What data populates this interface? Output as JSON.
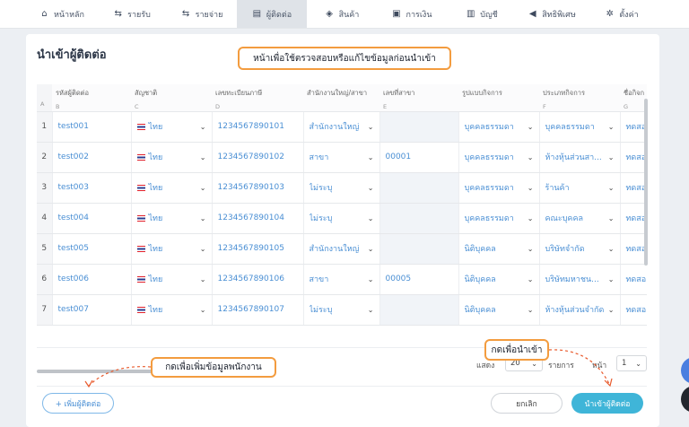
{
  "nav": [
    {
      "label": "หน้าหลัก",
      "icon": "home-icon",
      "glyph": "⌂",
      "active": false
    },
    {
      "label": "รายรับ",
      "icon": "income-icon",
      "glyph": "⇆",
      "active": false
    },
    {
      "label": "รายจ่าย",
      "icon": "expense-icon",
      "glyph": "⇆",
      "active": false
    },
    {
      "label": "ผู้ติดต่อ",
      "icon": "contacts-icon",
      "glyph": "▤",
      "active": true
    },
    {
      "label": "สินค้า",
      "icon": "product-box-icon",
      "glyph": "◈",
      "active": false
    },
    {
      "label": "การเงิน",
      "icon": "finance-icon",
      "glyph": "▣",
      "active": false
    },
    {
      "label": "บัญชี",
      "icon": "accounting-icon",
      "glyph": "▥",
      "active": false
    },
    {
      "label": "สิทธิพิเศษ",
      "icon": "megaphone-icon",
      "glyph": "◀",
      "active": false
    },
    {
      "label": "ตั้งค่า",
      "icon": "gear-icon",
      "glyph": "✲",
      "active": false
    }
  ],
  "page": {
    "title": "นำเข้าผู้ติดต่อ"
  },
  "callouts": {
    "top": "หน้าเพื่อใช้ตรวจสอบหรือแก้ไขข้อมูลก่อนนำเข้า",
    "left": "กดเพื่อเพิ่มข้อมูลพนักงาน",
    "right": "กดเพื่อนำเข้า"
  },
  "table": {
    "columns": [
      {
        "label": "",
        "letter": "A"
      },
      {
        "label": "รหัสผู้ติดต่อ",
        "letter": "B"
      },
      {
        "label": "สัญชาติ",
        "letter": "C"
      },
      {
        "label": "เลขทะเบียนภาษี",
        "letter": "D"
      },
      {
        "label": "สำนักงานใหญ่/สาขา",
        "letter": ""
      },
      {
        "label": "เลขที่สาขา",
        "letter": "E"
      },
      {
        "label": "รูปแบบกิจการ",
        "letter": ""
      },
      {
        "label": "ประเภทกิจการ",
        "letter": "F"
      },
      {
        "label": "ชื่อกิจก",
        "letter": "G"
      }
    ],
    "rows": [
      {
        "num": "1",
        "code": "test001",
        "nation": "ไทย",
        "tax": "1234567890101",
        "office": "สำนักงานใหญ่",
        "branch": "",
        "form": "บุคคลธรรมดา",
        "type": "บุคคลธรรมดา",
        "name": "ทดสอ"
      },
      {
        "num": "2",
        "code": "test002",
        "nation": "ไทย",
        "tax": "1234567890102",
        "office": "สาขา",
        "branch": "00001",
        "form": "บุคคลธรรมดา",
        "type": "ห้างหุ้นส่วนสา...",
        "name": "ทดสอ"
      },
      {
        "num": "3",
        "code": "test003",
        "nation": "ไทย",
        "tax": "1234567890103",
        "office": "ไม่ระบุ",
        "branch": "",
        "form": "บุคคลธรรมดา",
        "type": "ร้านค้า",
        "name": "ทดสอ"
      },
      {
        "num": "4",
        "code": "test004",
        "nation": "ไทย",
        "tax": "1234567890104",
        "office": "ไม่ระบุ",
        "branch": "",
        "form": "บุคคลธรรมดา",
        "type": "คณะบุคคล",
        "name": "ทดสอ"
      },
      {
        "num": "5",
        "code": "test005",
        "nation": "ไทย",
        "tax": "1234567890105",
        "office": "สำนักงานใหญ่",
        "branch": "",
        "form": "นิติบุคคล",
        "type": "บริษัทจำกัด",
        "name": "ทดสอ"
      },
      {
        "num": "6",
        "code": "test006",
        "nation": "ไทย",
        "tax": "1234567890106",
        "office": "สาขา",
        "branch": "00005",
        "form": "นิติบุคคล",
        "type": "บริษัทมหาชน...",
        "name": "ทดสอ"
      },
      {
        "num": "7",
        "code": "test007",
        "nation": "ไทย",
        "tax": "1234567890107",
        "office": "ไม่ระบุ",
        "branch": "",
        "form": "นิติบุคคล",
        "type": "ห้างหุ้นส่วนจำกัด",
        "name": "ทดสอ"
      }
    ]
  },
  "pagination": {
    "show_label": "แสดง",
    "per_page": "20",
    "items_label": "รายการ",
    "page_label": "หน้า",
    "page": "1"
  },
  "buttons": {
    "add": "+ เพิ่มผู้ติดต่อ",
    "cancel": "ยกเลิก",
    "import": "นำเข้าผู้ติดต่อ"
  },
  "colors": {
    "accent": "#3fb5d8",
    "callout_border": "#f39c3f",
    "link": "#4a8fd4",
    "arrow": "#e8592b"
  }
}
